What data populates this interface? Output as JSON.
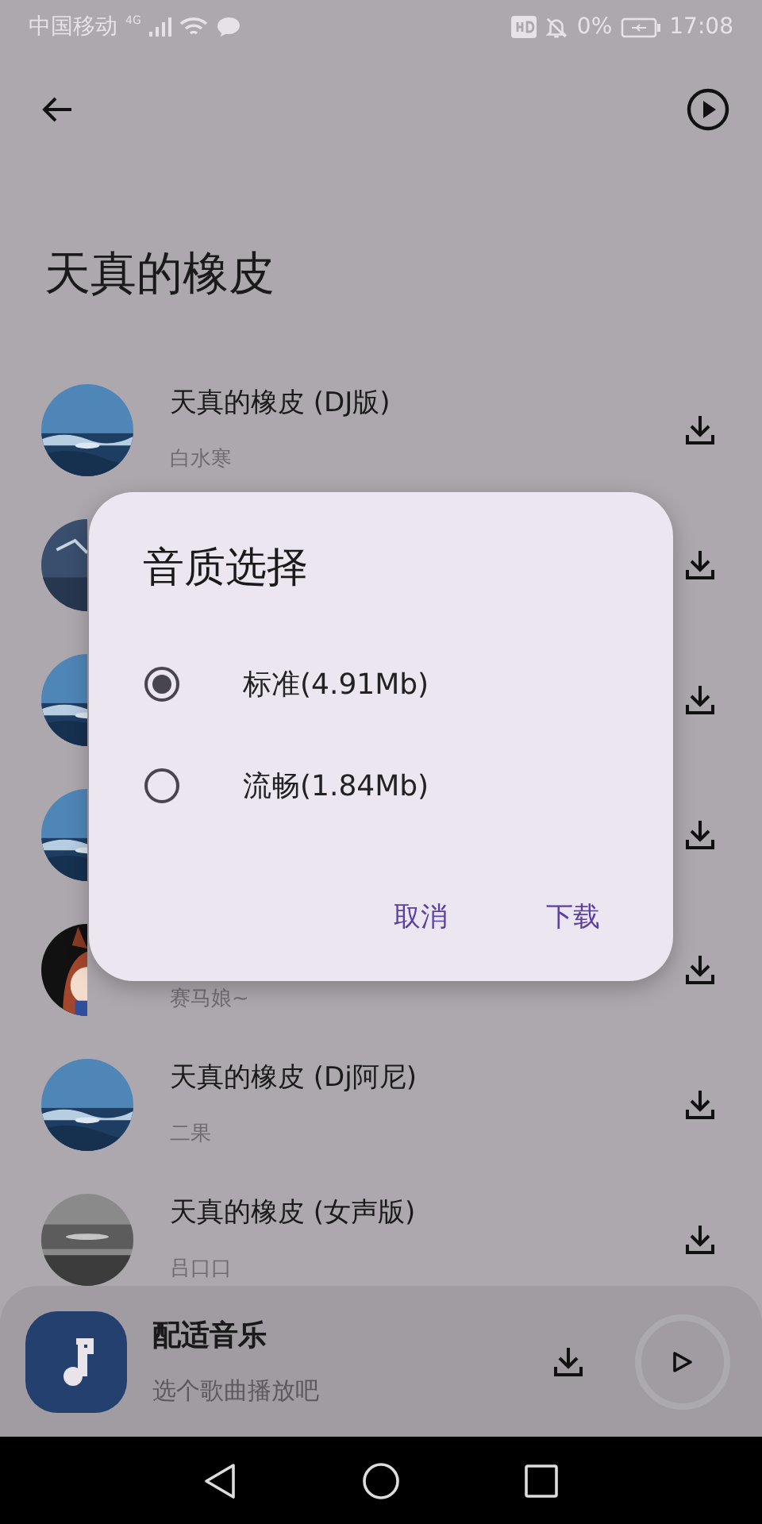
{
  "status_bar": {
    "carrier": "中国移动",
    "network": "4G",
    "battery": "0%",
    "time": "17:08"
  },
  "page": {
    "title": "天真的橡皮"
  },
  "songs": [
    {
      "title": "天真的橡皮 (DJ版)",
      "artist": "白水寒",
      "kind": "picture"
    },
    {
      "kind": "picture"
    },
    {
      "kind": "picture"
    },
    {
      "kind": "picture"
    },
    {
      "artist": "赛马娘~",
      "kind": "picture"
    },
    {
      "title": "天真的橡皮 (Dj阿尼)",
      "artist": "二果",
      "kind": "picture"
    },
    {
      "title": "天真的橡皮 (女声版)",
      "artist": "吕口口",
      "kind": "picture"
    }
  ],
  "dialog": {
    "title": "音质选择",
    "options": [
      {
        "label": "标准(4.91Mb)",
        "selected": true
      },
      {
        "label": "流畅(1.84Mb)",
        "selected": false
      }
    ],
    "buttons": [
      "取消",
      "下载"
    ]
  },
  "player": {
    "title": "配适音乐",
    "subtitle": "选个歌曲播放吧"
  }
}
